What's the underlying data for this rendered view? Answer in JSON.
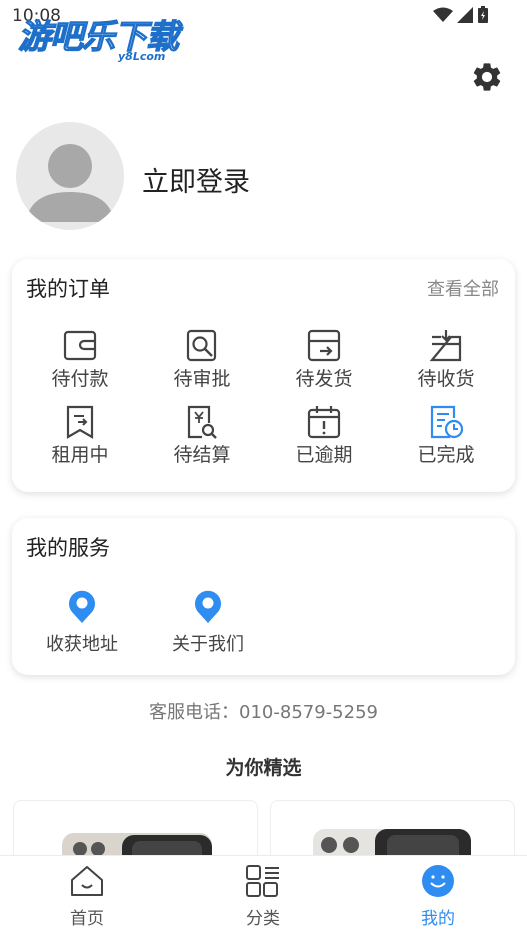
{
  "status_bar": {
    "time": "10:08"
  },
  "watermark": {
    "text": "游吧乐下载",
    "sub": "y8Lcom"
  },
  "profile": {
    "login_label": "立即登录"
  },
  "orders": {
    "title": "我的订单",
    "view_all": "查看全部",
    "items": [
      {
        "label": "待付款",
        "icon": "wallet-icon"
      },
      {
        "label": "待审批",
        "icon": "review-icon"
      },
      {
        "label": "待发货",
        "icon": "ship-icon"
      },
      {
        "label": "待收货",
        "icon": "receive-box-icon"
      },
      {
        "label": "租用中",
        "icon": "bookmark-icon"
      },
      {
        "label": "待结算",
        "icon": "invoice-search-icon"
      },
      {
        "label": "已逾期",
        "icon": "calendar-alert-icon"
      },
      {
        "label": "已完成",
        "icon": "document-clock-icon"
      }
    ]
  },
  "services": {
    "title": "我的服务",
    "items": [
      {
        "label": "收获地址",
        "icon": "location-pin-icon"
      },
      {
        "label": "关于我们",
        "icon": "location-pin-icon"
      }
    ]
  },
  "hotline": "客服电话：010-8579-5259",
  "picks_title": "为你精选",
  "tabbar": {
    "items": [
      {
        "label": "首页",
        "icon": "home-icon"
      },
      {
        "label": "分类",
        "icon": "category-grid-icon"
      },
      {
        "label": "我的",
        "icon": "smiley-icon"
      }
    ]
  },
  "colors": {
    "accent": "#2f8cf0",
    "text": "#222222",
    "muted": "#888888"
  }
}
